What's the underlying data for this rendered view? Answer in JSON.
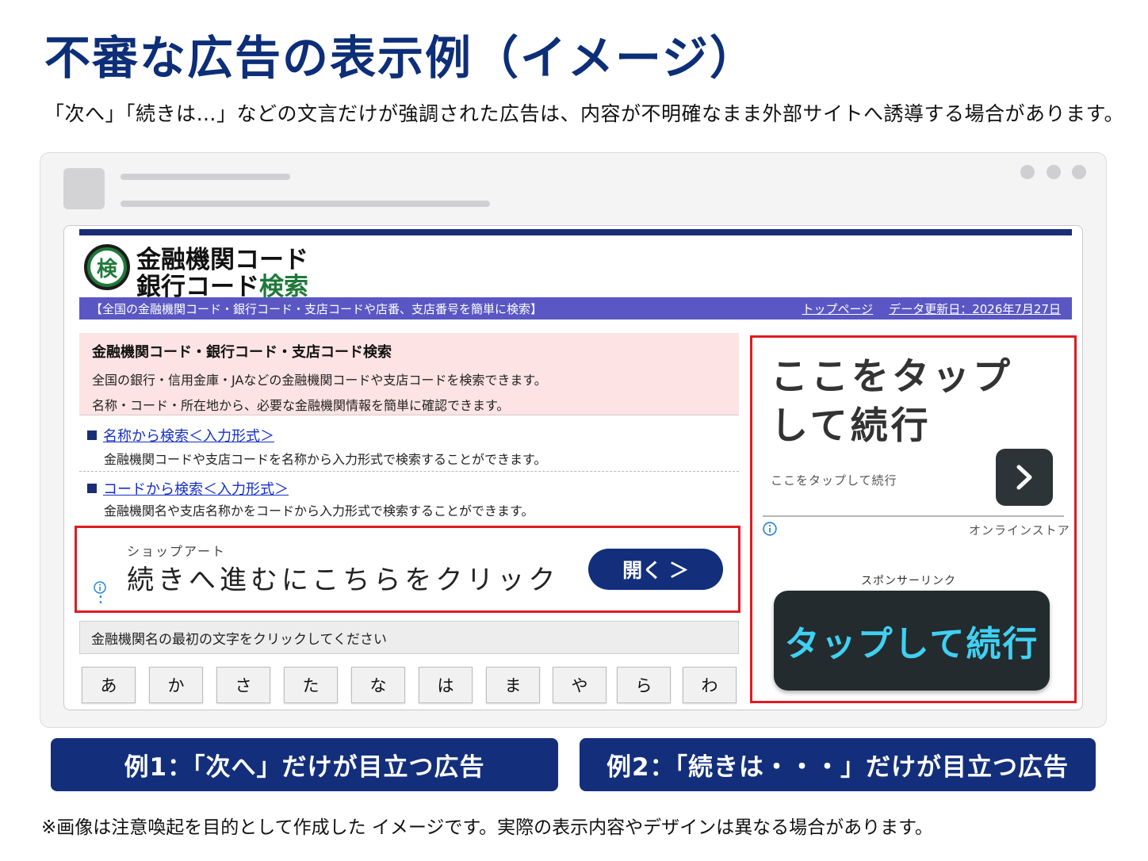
{
  "headline": "不審な広告の表示例（イメージ）",
  "lead": "「次へ」「続きは…」などの文言だけが強調された広告は、内容が不明確なまま外部サイトへ誘導する場合があります。",
  "site": {
    "logo_mark": "検",
    "logo_line1": "金融機関コード",
    "logo_line2_a": "銀行コード",
    "logo_line2_b": "検索",
    "bar_desc": "【全国の金融機関コード・銀行コード・支店コードや店番、支店番号を簡単に検索】",
    "bar_link_top": "トップページ",
    "bar_updated": "データ更新日：2026年7月27日",
    "intro_title": "金融機関コード・銀行コード・支店コード検索",
    "intro_line1": "全国の銀行・信用金庫・JAなどの金融機関コードや支店コードを検索できます。",
    "intro_line2": "名称・コード・所在地から、必要な金融機関情報を簡単に確認できます。",
    "section1_link": "名称から検索＜入力形式＞",
    "section1_desc": "金融機関コードや支店コードを名称から入力形式で検索することができます。",
    "section2_link": "コードから検索＜入力形式＞",
    "section2_desc": "金融機関名や支店名称かをコードから入力形式で検索することができます。",
    "kana_prompt": "金融機関名の最初の文字をクリックしてください",
    "kana": [
      "あ",
      "か",
      "さ",
      "た",
      "な",
      "は",
      "ま",
      "や",
      "ら",
      "わ"
    ]
  },
  "ad1": {
    "brand": "ショップアート",
    "text": "続きへ進むにこちらをクリック",
    "button": "開く ＞",
    "info_icon": "info-icon"
  },
  "ad2": {
    "headline": "ここをタップして続行",
    "subtext": "ここをタップして続行",
    "store": "オンラインストア",
    "sponsor": "スポンサーリンク",
    "button": "タップして続行",
    "info_icon": "info-icon"
  },
  "captions": {
    "example1": "例1：「次へ」だけが目立つ広告",
    "example2": "例2：「続きは・・・」だけが目立つ広告"
  },
  "footnote": "※画像は注意喚起を目的として作成した イメージです。実際の表示内容やデザインは異なる場合があります。",
  "colors": {
    "navy": "#132f7c",
    "alert_red": "#e01a22",
    "bar_purple": "#5a57c4",
    "logo_green": "#1f7a3a",
    "cta_cyan": "#3fd0f2"
  }
}
